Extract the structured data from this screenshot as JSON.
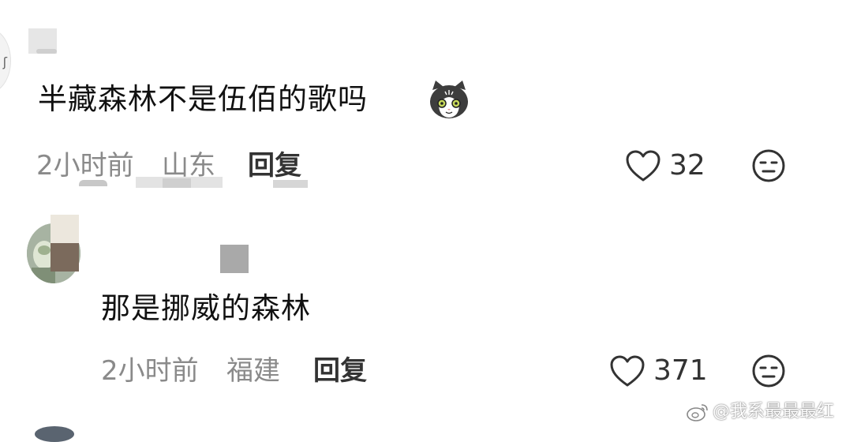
{
  "comments": [
    {
      "text": "半藏森林不是伍佰的歌吗",
      "emoji": "cat-emoji",
      "time": "2小时前",
      "location": "山东",
      "reply_label": "回复",
      "likes": "32"
    },
    {
      "text": "那是挪威的森林",
      "time": "2小时前",
      "location": "福建",
      "reply_label": "回复",
      "likes": "371"
    }
  ],
  "icons": {
    "like": "heart-outline-icon",
    "dislike": "neutral-face-icon"
  },
  "watermark": {
    "text": "@我系最最最红",
    "logo": "weibo-logo"
  },
  "colors": {
    "text": "#111111",
    "meta": "#8a8a8a",
    "icon": "#333333"
  }
}
